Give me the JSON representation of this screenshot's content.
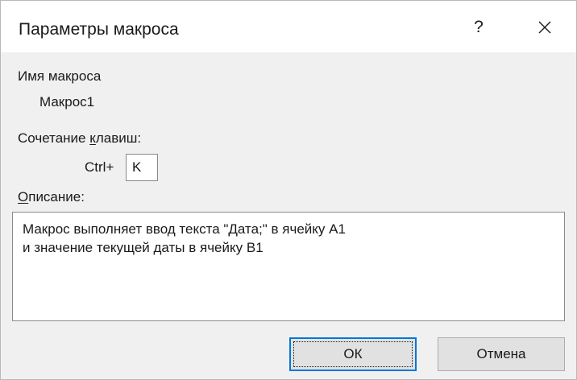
{
  "dialog": {
    "title": "Параметры макроса",
    "help_label": "?",
    "close_icon": "close-icon"
  },
  "macro_name": {
    "label": "Имя макроса",
    "value": "Макрос1"
  },
  "shortcut": {
    "label_before": "Сочетание ",
    "label_underlined": "к",
    "label_after": "лавиш:",
    "prefix": "Ctrl+",
    "key_value": "K"
  },
  "description": {
    "label_underlined": "О",
    "label_after": "писание:",
    "lines": [
      "Макрос выполняет ввод текста \"Дата;\" в ячейку А1",
      "и значение текущей даты в ячейку В1"
    ]
  },
  "buttons": {
    "ok_label": "ОК",
    "cancel_label": "Отмена"
  },
  "colors": {
    "accent": "#0078d7",
    "dialog_bg": "#f0f0f0",
    "button_bg": "#e1e1e1"
  }
}
